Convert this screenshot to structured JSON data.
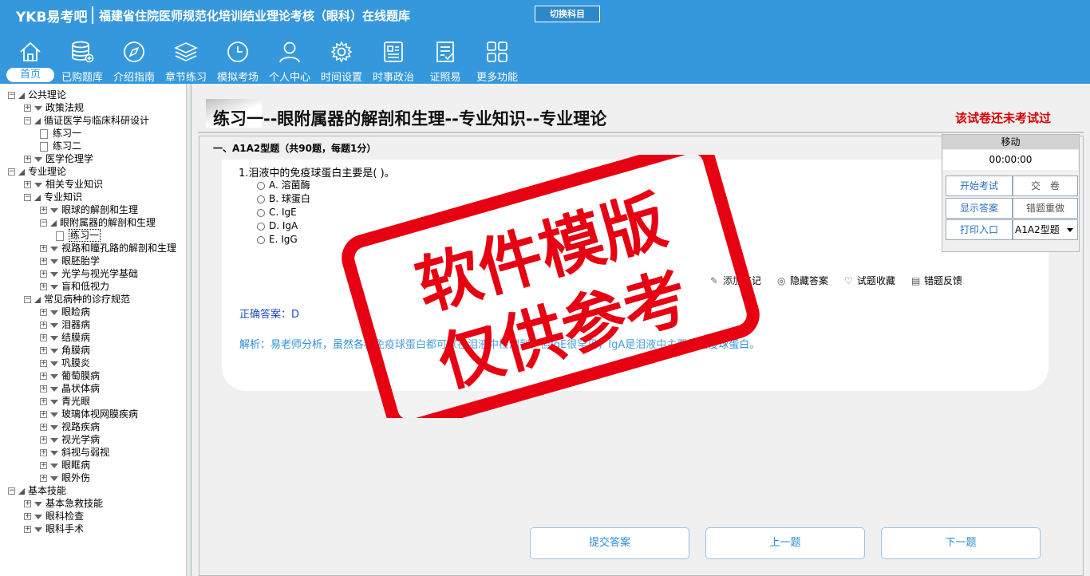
{
  "header": {
    "brand": "YKB易考吧",
    "title": "福建省住院医师规范化培训结业理论考核（眼科）在线题库",
    "switch_label": "切换科目"
  },
  "nav": {
    "items": [
      {
        "label": "首页",
        "icon": "home-icon"
      },
      {
        "label": "已购题库",
        "icon": "database-icon"
      },
      {
        "label": "介绍指南",
        "icon": "compass-icon"
      },
      {
        "label": "章节练习",
        "icon": "layers-icon"
      },
      {
        "label": "模拟考场",
        "icon": "clock-icon"
      },
      {
        "label": "个人中心",
        "icon": "user-icon"
      },
      {
        "label": "时间设置",
        "icon": "gear-icon"
      },
      {
        "label": "时事政治",
        "icon": "news-icon"
      },
      {
        "label": "证照易",
        "icon": "certificate-icon"
      },
      {
        "label": "更多功能",
        "icon": "grid-icon"
      }
    ]
  },
  "tree": [
    {
      "label": "公共理论",
      "level": 0,
      "type": "folder"
    },
    {
      "label": "政策法规",
      "level": 1,
      "type": "folder"
    },
    {
      "label": "循证医学与临床科研设计",
      "level": 1,
      "type": "folder"
    },
    {
      "label": "练习一",
      "level": 2,
      "type": "doc"
    },
    {
      "label": "练习二",
      "level": 2,
      "type": "doc"
    },
    {
      "label": "医学伦理学",
      "level": 1,
      "type": "folder"
    },
    {
      "label": "专业理论",
      "level": 0,
      "type": "folder"
    },
    {
      "label": "相关专业知识",
      "level": 1,
      "type": "folder"
    },
    {
      "label": "专业知识",
      "level": 1,
      "type": "folder"
    },
    {
      "label": "眼球的解剖和生理",
      "level": 2,
      "type": "folder"
    },
    {
      "label": "眼附属器的解剖和生理",
      "level": 2,
      "type": "folder"
    },
    {
      "label": "练习一",
      "level": 3,
      "type": "doc",
      "selected": true
    },
    {
      "label": "视路和瞳孔路的解剖和生理",
      "level": 2,
      "type": "folder"
    },
    {
      "label": "眼胚胎学",
      "level": 2,
      "type": "folder"
    },
    {
      "label": "光学与视光学基础",
      "level": 2,
      "type": "folder"
    },
    {
      "label": "盲和低视力",
      "level": 2,
      "type": "folder"
    },
    {
      "label": "常见病种的诊疗规范",
      "level": 1,
      "type": "folder"
    },
    {
      "label": "眼睑病",
      "level": 2,
      "type": "folder"
    },
    {
      "label": "泪器病",
      "level": 2,
      "type": "folder"
    },
    {
      "label": "结膜病",
      "level": 2,
      "type": "folder"
    },
    {
      "label": "角膜病",
      "level": 2,
      "type": "folder"
    },
    {
      "label": "巩膜炎",
      "level": 2,
      "type": "folder"
    },
    {
      "label": "葡萄膜病",
      "level": 2,
      "type": "folder"
    },
    {
      "label": "晶状体病",
      "level": 2,
      "type": "folder"
    },
    {
      "label": "青光眼",
      "level": 2,
      "type": "folder"
    },
    {
      "label": "玻璃体视网膜疾病",
      "level": 2,
      "type": "folder"
    },
    {
      "label": "视路疾病",
      "level": 2,
      "type": "folder"
    },
    {
      "label": "视光学病",
      "level": 2,
      "type": "folder"
    },
    {
      "label": "斜视与弱视",
      "level": 2,
      "type": "folder"
    },
    {
      "label": "眼眶病",
      "level": 2,
      "type": "folder"
    },
    {
      "label": "眼外伤",
      "level": 2,
      "type": "folder"
    },
    {
      "label": "基本技能",
      "level": 0,
      "type": "folder"
    },
    {
      "label": "基本急救技能",
      "level": 1,
      "type": "folder"
    },
    {
      "label": "眼科检查",
      "level": 1,
      "type": "folder"
    },
    {
      "label": "眼科手术",
      "level": 1,
      "type": "folder"
    }
  ],
  "main": {
    "page_title": "练习一--眼附属器的解剖和生理--专业知识--专业理论",
    "status": "该试卷还未考试过",
    "section": "一、A1A2型题（共90题，每题1分）",
    "question": "1.泪液中的免疫球蛋白主要是( )。",
    "options": [
      "A. 溶菌酶",
      "B. 球蛋白",
      "C. IgE",
      "D. IgA",
      "E. IgG"
    ],
    "actions": {
      "note": "添加笔记",
      "hide_answer": "隐藏答案",
      "favorite": "试题收藏",
      "feedback": "错题反馈"
    },
    "answer": "正确答案：D",
    "analysis": "解析：易老师分析，虽然各种免疫球蛋白都可以在泪液中检测到，但IgE很罕见，IgA是泪液中主要的免疫球蛋白。"
  },
  "panel": {
    "move": "移动",
    "timer": "00:00:00",
    "start": "开始考试",
    "submit": "交　卷",
    "show_answer": "显示答案",
    "redo_wrong": "错题重做",
    "print": "打印入口",
    "type_select": "A1A2型题"
  },
  "bottom": {
    "submit_answer": "提交答案",
    "prev": "上一题",
    "next": "下一题"
  },
  "stamp": {
    "line1": "软件模版",
    "line2": "仅供参考",
    "color": "#e60012"
  }
}
